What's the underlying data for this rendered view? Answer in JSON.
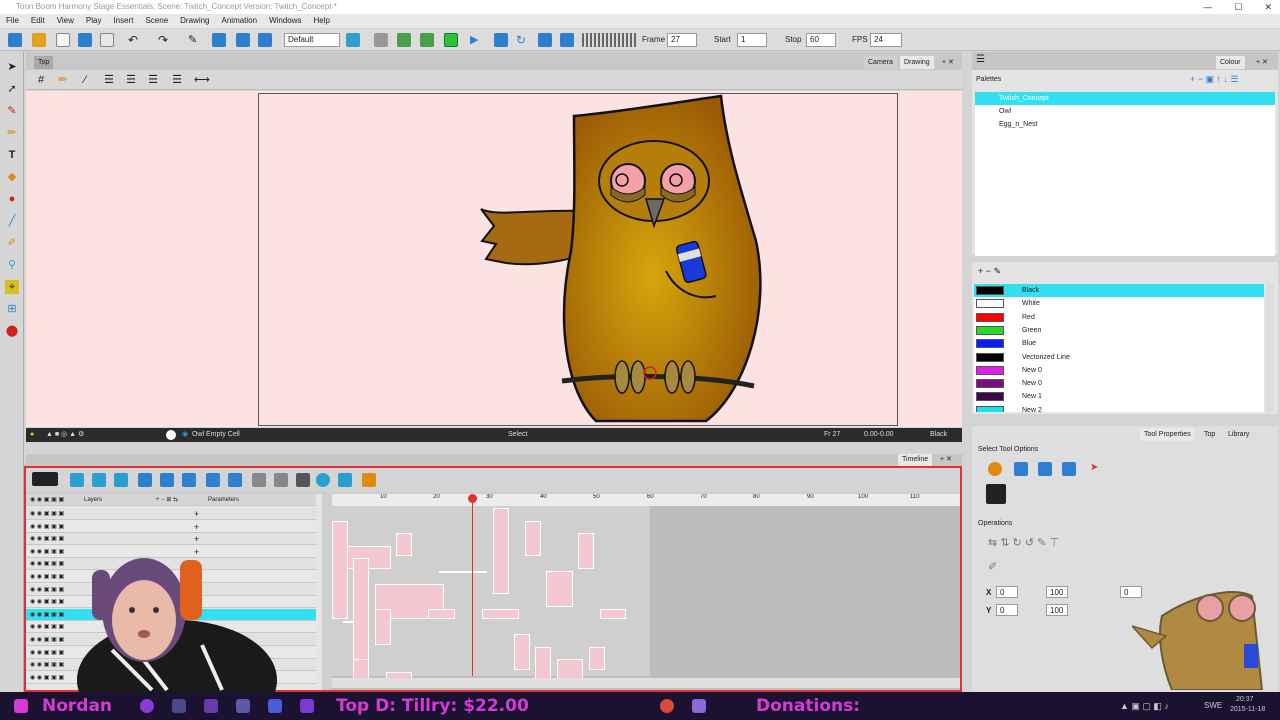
{
  "window": {
    "title": "Toon Boom Harmony Stage Essentials: Scene: Twitch_Concept Version: Twitch_Concept *",
    "controls": [
      "—",
      "☐",
      "✕"
    ]
  },
  "menu": [
    "File",
    "Edit",
    "View",
    "Play",
    "Insert",
    "Scene",
    "Drawing",
    "Animation",
    "Windows",
    "Help"
  ],
  "toolbar": {
    "workspace": "Default",
    "frame_label": "Frame",
    "frame_value": "27",
    "start_label": "Start",
    "start_value": "1",
    "stop_label": "Stop",
    "stop_value": "60",
    "fps_label": "FPS",
    "fps_value": "24"
  },
  "view": {
    "panel_title": "Top",
    "tabs": [
      "Camera",
      "Drawing"
    ],
    "status_left": "Owl Empty Cell",
    "status_mid": "Select",
    "status_frame": "Fr 27",
    "status_coords": "0.00-0.00",
    "status_color": "Black"
  },
  "timeline": {
    "tab": "Timeline",
    "layers_label": "Layers",
    "parameters_label": "Parameters",
    "ruler": [
      "10",
      "20",
      "30",
      "40",
      "50",
      "60",
      "70",
      "80",
      "90",
      "100",
      "110"
    ],
    "current_frame": 27
  },
  "colour_panel": {
    "tab": "Colour",
    "palettes_label": "Palettes",
    "palettes": [
      "Twitch_Concept",
      "Owl",
      "Egg_n_Nest"
    ],
    "colors": [
      {
        "name": "Black",
        "hex": "#000000"
      },
      {
        "name": "White",
        "hex": "#ffffff"
      },
      {
        "name": "Red",
        "hex": "#ff0000"
      },
      {
        "name": "Green",
        "hex": "#28d828"
      },
      {
        "name": "Blue",
        "hex": "#0a1cff"
      },
      {
        "name": "Vectorized Line",
        "hex": "#000000"
      },
      {
        "name": "New 0",
        "hex": "#e020e8"
      },
      {
        "name": "New 0",
        "hex": "#7a1080"
      },
      {
        "name": "New 1",
        "hex": "#3a0a40"
      },
      {
        "name": "New 2",
        "hex": "#20e0ee"
      }
    ]
  },
  "tool_properties": {
    "tabs": [
      "Tool Properties",
      "Top",
      "Library"
    ],
    "select_options": "Select Tool Options",
    "operations": "Operations",
    "x_label": "X",
    "y_label": "Y",
    "x_value": "0",
    "y_value": "0",
    "w_value": "100",
    "h_value": "100",
    "angle_value": "0"
  },
  "taskbar": {
    "brand": "Nordan",
    "top_donor": "Top D: Tillry: $22.00",
    "donations": "Donations:",
    "lang": "SWE",
    "time": "20:37",
    "date": "2015-11-18"
  },
  "colors": {
    "accent": "#33e0f0",
    "timeline_border": "#e03030",
    "canvas_bg": "#fde2e2",
    "taskbar_bg": "#1a1230",
    "taskbar_text": "#d43ad8"
  }
}
